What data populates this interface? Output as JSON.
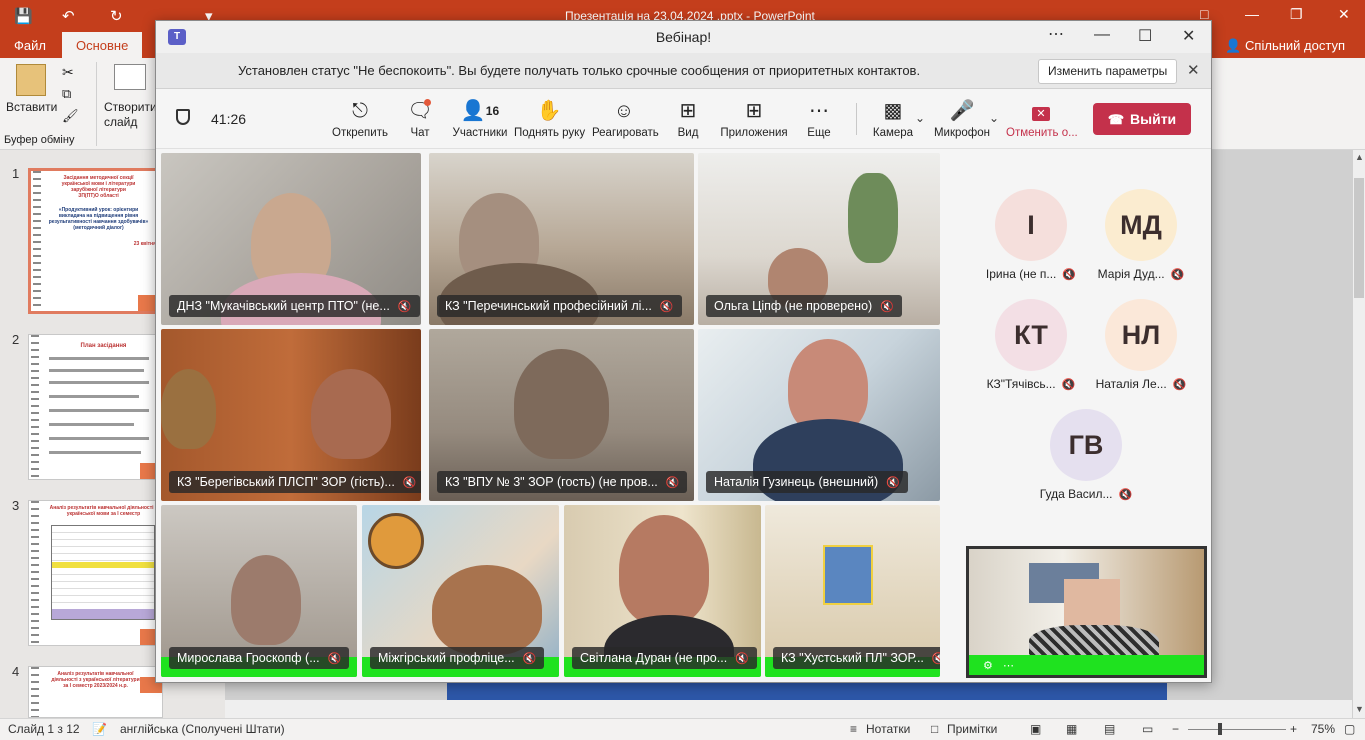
{
  "powerpoint": {
    "title": "Презентація на 23.04.2024 .pptx - PowerPoint",
    "tabs": [
      "Файл",
      "Основне"
    ],
    "share": "Спільний доступ",
    "ribbon": {
      "paste": "Вставити",
      "new_slide": "Створити слайд",
      "clipboard": "Буфер обміну"
    },
    "slide_numbers": [
      "1",
      "2",
      "3",
      "4"
    ],
    "thumb1_lines": [
      "Засідання методичної секції",
      "української мови і літератури",
      "зарубіжної літератури",
      "ЗП(ПТ)О області",
      "«Продуктивний урок: орієнтири",
      "викладача на підвищення рівня",
      "результативності навчання здобувачів»",
      "(методичний діалог)",
      "23 квітня"
    ],
    "thumb2_title": "План засідання",
    "thumb3_title": "Аналіз результатів навчальної діяльності з української мови за І семестр",
    "thumb4_title": "Аналіз результатів навчальної діяльності з української літератури за І семестр 2023/2024 н.р.",
    "status": {
      "slide": "Слайд 1 з 12",
      "language": "англійська (Сполучені Штати)",
      "notes": "Нотатки",
      "comments": "Примітки",
      "zoom": "75%"
    }
  },
  "teams": {
    "window_title": "Вебінар!",
    "banner": {
      "text": "Установлен статус \"Не беспокоить\". Вы будете получать только срочные сообщения от приоритетных контактов.",
      "button": "Изменить параметры"
    },
    "timer": "41:26",
    "toolbar": {
      "unpin": "Открепить",
      "chat": "Чат",
      "participants": "Участники",
      "participants_count": "16",
      "raise_hand": "Поднять руку",
      "react": "Реагировать",
      "view": "Вид",
      "apps": "Приложения",
      "more": "Еще",
      "camera": "Камера",
      "microphone": "Микрофон",
      "cancel": "Отменить о...",
      "leave": "Выйти"
    },
    "tiles": [
      "ДНЗ \"Мукачівський центр ПТО\" (не...",
      "КЗ \"Перечинський професійний лі...",
      "Ольга Ціпф (не проверено)",
      "КЗ \"Берегівський ПЛСП\" ЗОР (гість)...",
      "КЗ \"ВПУ № 3\" ЗОР (гость) (не пров...",
      "Наталія Гузинець (внешний)",
      "Мирослава Гроскопф (...",
      "Міжгірський профліце...",
      "Світлана Дуран (не про...",
      "КЗ \"Хустський ПЛ\" ЗОР..."
    ],
    "avatars": [
      {
        "initials": "І",
        "name": "Ірина (не п...",
        "color": "#f5dfdc"
      },
      {
        "initials": "МД",
        "name": "Марія Дуд...",
        "color": "#fbecd0"
      },
      {
        "initials": "КТ",
        "name": "КЗ\"Тячівсь...",
        "color": "#f3dfe5"
      },
      {
        "initials": "НЛ",
        "name": "Наталія Ле...",
        "color": "#fbe8d9"
      },
      {
        "initials": "ГВ",
        "name": "Гуда Васил...",
        "color": "#e5e0ef"
      }
    ]
  }
}
